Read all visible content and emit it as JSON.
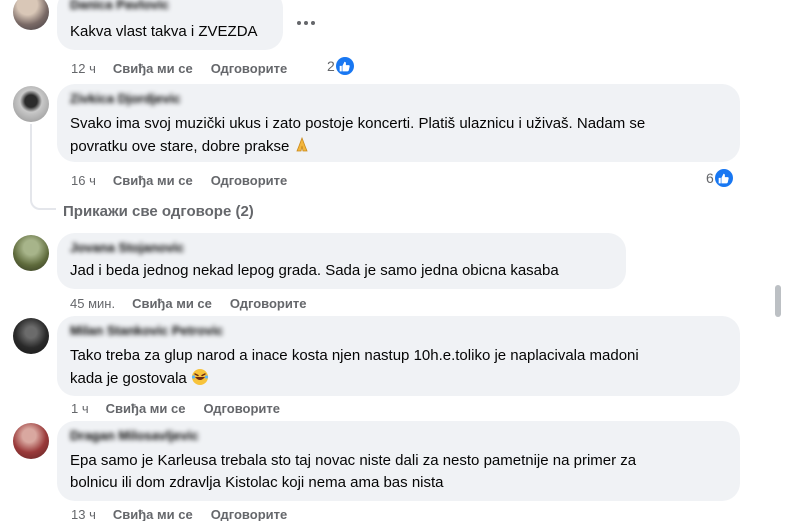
{
  "comments": [
    {
      "id": "c1",
      "author": "Danica Pavlovic",
      "text_lines": [
        "Kakva vlast takva i ZVEZDA"
      ],
      "time": "12 ч",
      "like_label": "Свиђа ми се",
      "reply_label": "Одговорите",
      "reactions": "2"
    },
    {
      "id": "c2",
      "author": "Zivkica Djordjevic",
      "text_lines": [
        "Svako ima svoj muzički ukus i zato postoje koncerti. Platiš ulaznicu i uživaš. Nadam se",
        "povratku ove stare, dobre prakse"
      ],
      "time": "16 ч",
      "like_label": "Свиђа ми се",
      "reply_label": "Одговорите",
      "reactions": "6",
      "view_replies": "Прикажи све одговоре (2)"
    },
    {
      "id": "c3",
      "author": "Jovana Stojanovic",
      "text_lines": [
        "Jad i beda jednog nekad lepog grada. Sada je samo jedna obicna kasaba"
      ],
      "time": "45 мин.",
      "like_label": "Свиђа ми се",
      "reply_label": "Одговорите"
    },
    {
      "id": "c4",
      "author": "Milan Stankovic Petrovic",
      "text_lines": [
        "Tako treba za glup narod a inace kosta njen nastup 10h.e.toliko je naplacivala madoni",
        "kada je gostovala"
      ],
      "time": "1 ч",
      "like_label": "Свиђа ми се",
      "reply_label": "Одговорите"
    },
    {
      "id": "c5",
      "author": "Dragan Milosavljevic",
      "text_lines": [
        "Epa samo je Karleusa trebala sto taj novac niste dali za nesto pametnije na primer za",
        "bolnicu ili dom zdravlja Kistolac koji nema ama bas nista"
      ],
      "time": "13 ч",
      "like_label": "Свиђа ми се",
      "reply_label": "Одговорите"
    }
  ],
  "colors": {
    "bubble": "#f0f2f5",
    "meta": "#65676b",
    "like_blue": "#1877f2"
  },
  "icons": {
    "more": "more-options-icon",
    "like": "like-thumb-icon",
    "emoji_c2": "folded-hands-emoji",
    "emoji_c4": "laughing-tears-emoji"
  }
}
